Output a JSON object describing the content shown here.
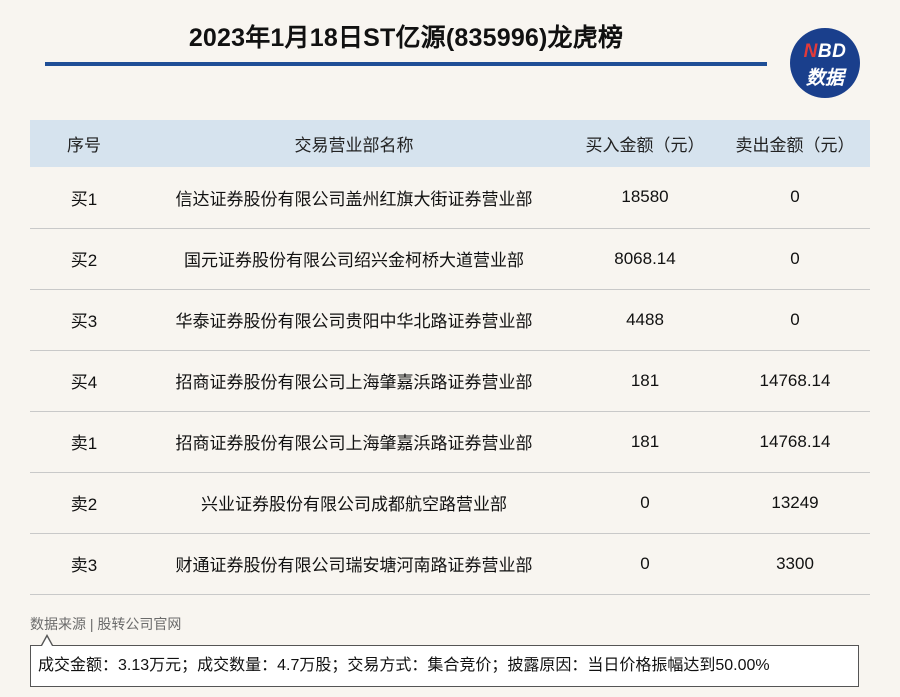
{
  "title": "2023年1月18日ST亿源(835996)龙虎榜",
  "logo": {
    "line1_n": "N",
    "line1_rest": "BD",
    "line2": "数据"
  },
  "table": {
    "headers": [
      "序号",
      "交易营业部名称",
      "买入金额（元）",
      "卖出金额（元）"
    ],
    "rows": [
      [
        "买1",
        "信达证券股份有限公司盖州红旗大街证券营业部",
        "18580",
        "0"
      ],
      [
        "买2",
        "国元证券股份有限公司绍兴金柯桥大道营业部",
        "8068.14",
        "0"
      ],
      [
        "买3",
        "华泰证券股份有限公司贵阳中华北路证券营业部",
        "4488",
        "0"
      ],
      [
        "买4",
        "招商证券股份有限公司上海肇嘉浜路证券营业部",
        "181",
        "14768.14"
      ],
      [
        "卖1",
        "招商证券股份有限公司上海肇嘉浜路证券营业部",
        "181",
        "14768.14"
      ],
      [
        "卖2",
        "兴业证券股份有限公司成都航空路营业部",
        "0",
        "13249"
      ],
      [
        "卖3",
        "财通证券股份有限公司瑞安塘河南路证券营业部",
        "0",
        "3300"
      ]
    ]
  },
  "source": "数据来源 | 股转公司官网",
  "note": "成交金额：3.13万元；成交数量：4.7万股；交易方式：集合竞价；披露原因：当日价格振幅达到50.00%"
}
